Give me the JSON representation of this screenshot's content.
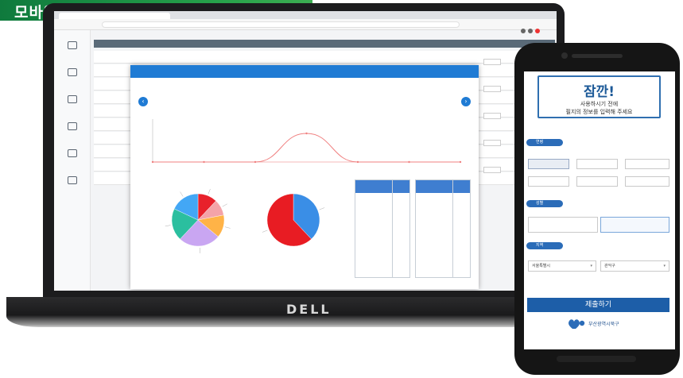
{
  "banner": {
    "title": "모바일 대기 화면 예시"
  },
  "laptop": {
    "brand": "DELL",
    "browser": {
      "url": ""
    },
    "sidebar": {
      "items": [
        {
          "label": "",
          "icon": "list-icon"
        },
        {
          "label": "",
          "icon": "document-icon"
        },
        {
          "label": "",
          "icon": "user-icon"
        },
        {
          "label": "",
          "icon": "chart-icon"
        },
        {
          "label": "",
          "icon": "settings-icon"
        },
        {
          "label": "",
          "icon": "help-icon"
        }
      ]
    },
    "modal": {
      "header": "",
      "chart_title": "",
      "y_label": "",
      "pie1_title": "",
      "pie2_title": "",
      "table1": {
        "headers": [
          "",
          ""
        ],
        "rows": [
          [
            "",
            ""
          ],
          [
            "",
            ""
          ],
          [
            "",
            ""
          ],
          [
            "",
            ""
          ],
          [
            "",
            ""
          ],
          [
            "",
            ""
          ]
        ]
      },
      "table2": {
        "headers": [
          "",
          ""
        ],
        "rows": [
          [
            "",
            ""
          ],
          [
            "",
            ""
          ],
          [
            "",
            ""
          ]
        ]
      },
      "pager": ""
    }
  },
  "chart_data": [
    {
      "type": "line",
      "title": "",
      "x": [
        "",
        "",
        "",
        "",
        "",
        "",
        ""
      ],
      "series": [
        {
          "values": [
            0,
            0,
            0,
            2,
            0,
            0,
            0
          ]
        }
      ],
      "ylim": [
        0,
        3
      ],
      "grid": false,
      "colors": [
        "#f08080"
      ]
    },
    {
      "type": "pie",
      "slices": [
        {
          "value": 12,
          "color": "#e8212b"
        },
        {
          "value": 10,
          "color": "#f4a3a8"
        },
        {
          "value": 14,
          "color": "#ffb347"
        },
        {
          "value": 26,
          "color": "#c9a6f2"
        },
        {
          "value": 20,
          "color": "#2bbf9f"
        },
        {
          "value": 18,
          "color": "#43a7f5"
        }
      ]
    },
    {
      "type": "pie",
      "slices": [
        {
          "value": 38,
          "color": "#3a8ee6"
        },
        {
          "value": 62,
          "color": "#e81c23"
        }
      ]
    }
  ],
  "phone": {
    "alert": {
      "title": "잠깐!",
      "line1": "사용하시기 전에",
      "line2": "필지의 정보를 입력해 주세요"
    },
    "sections": {
      "age": "연령",
      "gender": "성별",
      "region": "지역"
    },
    "age_options": [
      "",
      "",
      "",
      "",
      "",
      ""
    ],
    "gender_options": [
      "",
      ""
    ],
    "region": {
      "city": "서울특별시",
      "district": "관악구"
    },
    "submit_label": "제출하기",
    "org_name": "부산광역시북구",
    "colors": {
      "primary": "#1d5ea8",
      "accent": "#2b6cb8"
    }
  }
}
